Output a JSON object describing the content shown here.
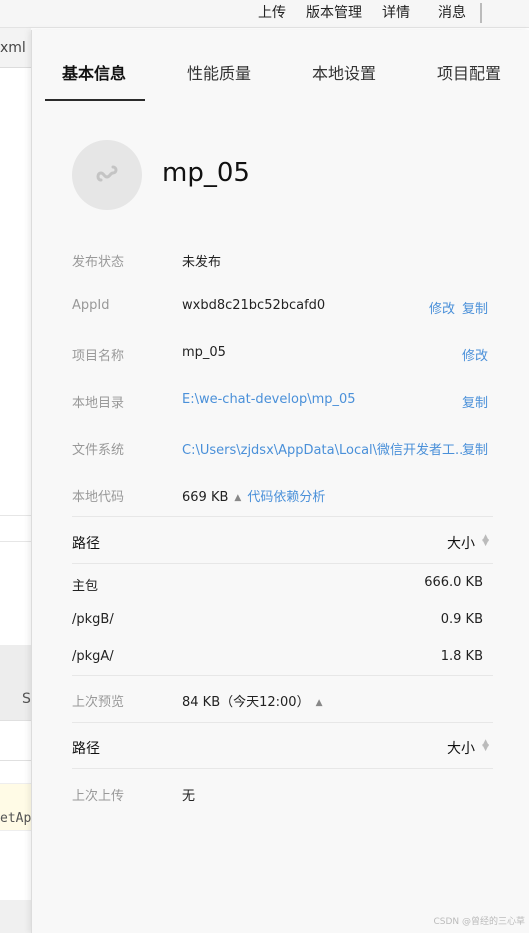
{
  "menu": {
    "upload": "上传",
    "version_management": "版本管理",
    "details": "详情",
    "messages": "消息"
  },
  "background": {
    "tab_fragment": "xml",
    "s_fragment": "S",
    "code_fragment": "etAp"
  },
  "tabs": [
    {
      "label": "基本信息",
      "active": true
    },
    {
      "label": "性能质量",
      "active": false
    },
    {
      "label": "本地设置",
      "active": false
    },
    {
      "label": "项目配置",
      "active": false
    }
  ],
  "project": {
    "name": "mp_05",
    "avatar_icon": "mini-program-icon"
  },
  "rows": {
    "publish_status": {
      "label": "发布状态",
      "value": "未发布"
    },
    "appid": {
      "label": "AppId",
      "value": "wxbd8c21bc52bcafd0",
      "action_edit": "修改",
      "action_copy": "复制"
    },
    "project_name": {
      "label": "项目名称",
      "value": "mp_05",
      "action": "修改"
    },
    "local_dir": {
      "label": "本地目录",
      "value": "E:\\we-chat-develop\\mp_05",
      "action": "复制"
    },
    "file_system": {
      "label": "文件系统",
      "value": "C:\\Users\\zjdsx\\AppData\\Local\\微信开发者工...",
      "action": "复制"
    },
    "local_code": {
      "label": "本地代码",
      "value": "669 KB",
      "link": "代码依赖分析"
    },
    "last_preview": {
      "label": "上次预览",
      "value": "84 KB（今天12:00）"
    },
    "last_upload": {
      "label": "上次上传",
      "value": "无"
    }
  },
  "local_code_table": {
    "col_path": "路径",
    "col_size": "大小",
    "rows": [
      {
        "path": "主包",
        "size": "666.0 KB"
      },
      {
        "path": "/pkgB/",
        "size": "0.9 KB"
      },
      {
        "path": "/pkgA/",
        "size": "1.8 KB"
      }
    ]
  },
  "preview_table": {
    "col_path": "路径",
    "col_size": "大小"
  },
  "watermark": "CSDN @曾经的三心草",
  "colors": {
    "link": "#4a90d9",
    "label": "#999999",
    "panel_bg": "#f8f8f8"
  }
}
